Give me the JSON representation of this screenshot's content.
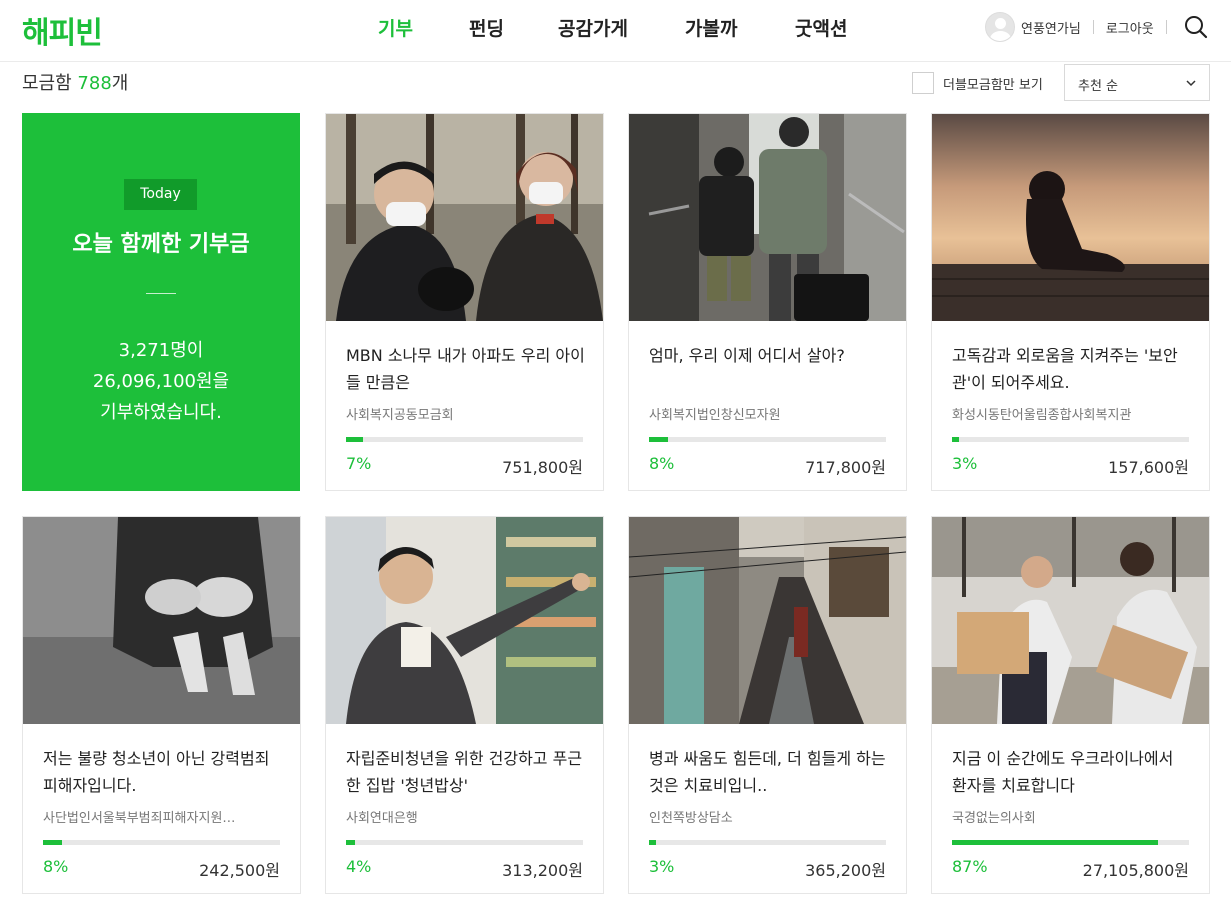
{
  "header": {
    "logo": "해피빈",
    "nav": [
      {
        "label": "기부",
        "active": true
      },
      {
        "label": "펀딩",
        "active": false
      },
      {
        "label": "공감가게",
        "active": false
      },
      {
        "label": "가볼까",
        "active": false
      },
      {
        "label": "굿액션",
        "active": false
      }
    ],
    "user_name": "연풍연가님",
    "logout_label": "로그아웃"
  },
  "summary": {
    "prefix": "모금함",
    "count": "788",
    "suffix": "개"
  },
  "filters": {
    "double_only_label": "더블모금함만 보기",
    "sort_selected": "추천 순"
  },
  "today": {
    "badge": "Today",
    "title": "오늘 함께한 기부금",
    "line1": "3,271명이",
    "line2": "26,096,100원을",
    "line3": "기부하였습니다."
  },
  "cards": [
    {
      "title": "MBN 소나무 내가 아파도 우리 아이들 만큼은",
      "org": "사회복지공동모금회",
      "percent_label": "7%",
      "progress": 0.07,
      "amount": "751,800원"
    },
    {
      "title": "엄마, 우리 이제 어디서 살아?",
      "org": "사회복지법인창신모자원",
      "percent_label": "8%",
      "progress": 0.08,
      "amount": "717,800원"
    },
    {
      "title": "고독감과 외로움을 지켜주는 '보안관'이 되어주세요.",
      "org": "화성시동탄어울림종합사회복지관",
      "percent_label": "3%",
      "progress": 0.03,
      "amount": "157,600원"
    },
    {
      "title": "저는 불량 청소년이 아닌 강력범죄 피해자입니다.",
      "org": "사단법인서울북부범죄피해자지원…",
      "percent_label": "8%",
      "progress": 0.08,
      "amount": "242,500원"
    },
    {
      "title": "자립준비청년을 위한 건강하고 푸근한 집밥 '청년밥상'",
      "org": "사회연대은행",
      "percent_label": "4%",
      "progress": 0.04,
      "amount": "313,200원"
    },
    {
      "title": "병과 싸움도 힘든데, 더 힘들게 하는 것은 치료비입니..",
      "org": "인천쪽방상담소",
      "percent_label": "3%",
      "progress": 0.03,
      "amount": "365,200원"
    },
    {
      "title": "지금 이 순간에도 우크라이나에서 환자를 치료합니다",
      "org": "국경없는의사회",
      "percent_label": "87%",
      "progress": 0.87,
      "amount": "27,105,800원"
    }
  ],
  "colors": {
    "brand_green": "#1dbf3a",
    "badge_green": "#119b2a"
  }
}
